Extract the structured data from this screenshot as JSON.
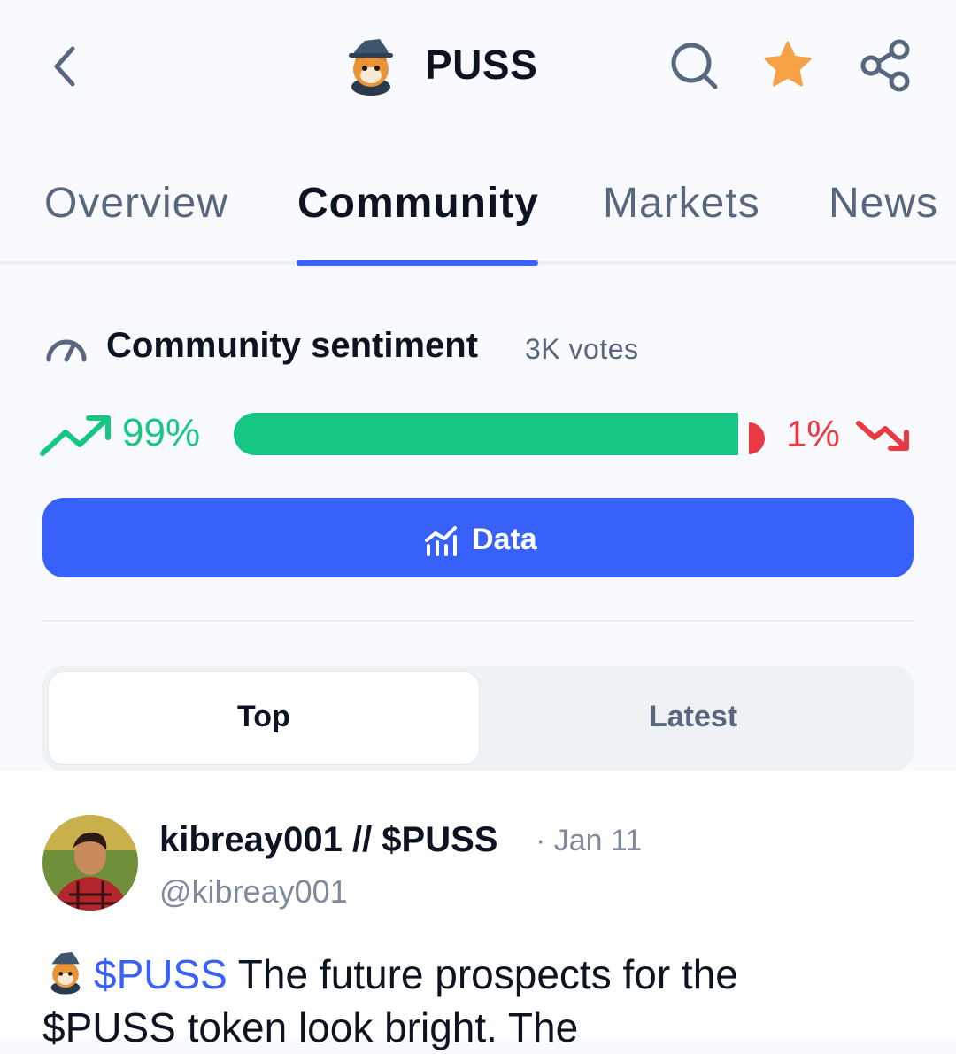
{
  "header": {
    "title": "PUSS",
    "star_color": "#f7a246"
  },
  "tabs": [
    {
      "label": "Overview"
    },
    {
      "label": "Community"
    },
    {
      "label": "Markets"
    },
    {
      "label": "News"
    }
  ],
  "sentiment": {
    "title": "Community sentiment",
    "votes": "3K votes",
    "bullish_pct_label": "99%",
    "bearish_pct_label": "1%",
    "bullish_fraction": 0.99,
    "bullish_color": "#16c784",
    "bearish_color": "#ea3943"
  },
  "data_button": {
    "label": "Data"
  },
  "segment": {
    "top_label": "Top",
    "latest_label": "Latest",
    "selected": "Top"
  },
  "post": {
    "author": "kibreay001 // $PUSS",
    "date": "· Jan 11",
    "handle": "@kibreay001",
    "tag": "$PUSS",
    "text_line1": " The future prospects for the",
    "text_line2": "$PUSS token look bright. The"
  },
  "icons": [
    "back-arrow-icon",
    "puss-logo-icon",
    "search-icon",
    "star-icon",
    "share-icon",
    "gauge-icon",
    "trend-up-icon",
    "trend-down-icon",
    "chart-icon"
  ]
}
